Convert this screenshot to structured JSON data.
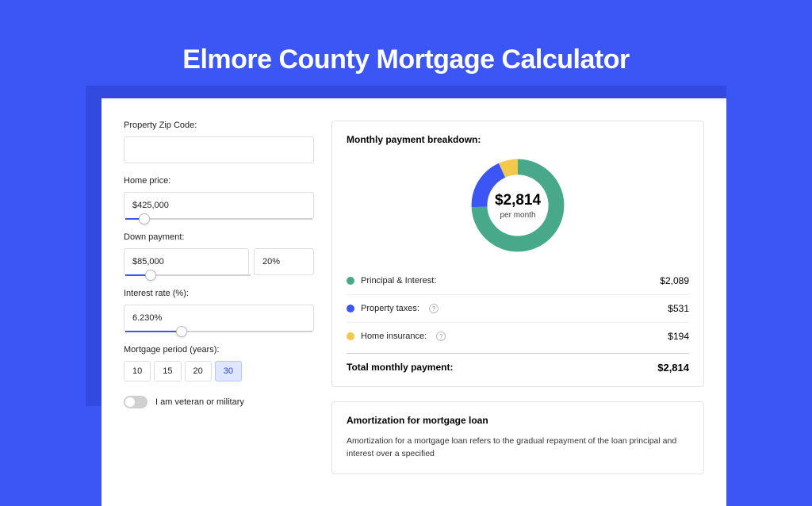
{
  "page_title": "Elmore County Mortgage Calculator",
  "form": {
    "zip_label": "Property Zip Code:",
    "zip_value": "",
    "home_price_label": "Home price:",
    "home_price_value": "$425,000",
    "home_price_slider_pct": 10,
    "down_payment_label": "Down payment:",
    "down_payment_value": "$85,000",
    "down_payment_pct_value": "20%",
    "down_payment_slider_pct": 20,
    "interest_label": "Interest rate (%):",
    "interest_value": "6.230%",
    "interest_slider_pct": 30,
    "period_label": "Mortgage period (years):",
    "period_options": [
      "10",
      "15",
      "20",
      "30"
    ],
    "period_selected": "30",
    "veteran_label": "I am veteran or military",
    "veteran_on": false
  },
  "breakdown": {
    "title": "Monthly payment breakdown:",
    "center_amount": "$2,814",
    "center_sub": "per month",
    "items": [
      {
        "label": "Principal & Interest:",
        "value": "$2,089",
        "color": "#47A98A",
        "info": false
      },
      {
        "label": "Property taxes:",
        "value": "$531",
        "color": "#3B56F5",
        "info": true
      },
      {
        "label": "Home insurance:",
        "value": "$194",
        "color": "#F2C94C",
        "info": true
      }
    ],
    "total_label": "Total monthly payment:",
    "total_value": "$2,814"
  },
  "chart_data": {
    "type": "pie",
    "title": "Monthly payment breakdown",
    "series": [
      {
        "name": "Principal & Interest",
        "value": 2089,
        "color": "#47A98A"
      },
      {
        "name": "Property taxes",
        "value": 531,
        "color": "#3B56F5"
      },
      {
        "name": "Home insurance",
        "value": 194,
        "color": "#F2C94C"
      }
    ],
    "total": 2814,
    "center_label": "$2,814 per month"
  },
  "amortization": {
    "title": "Amortization for mortgage loan",
    "body": "Amortization for a mortgage loan refers to the gradual repayment of the loan principal and interest over a specified"
  }
}
